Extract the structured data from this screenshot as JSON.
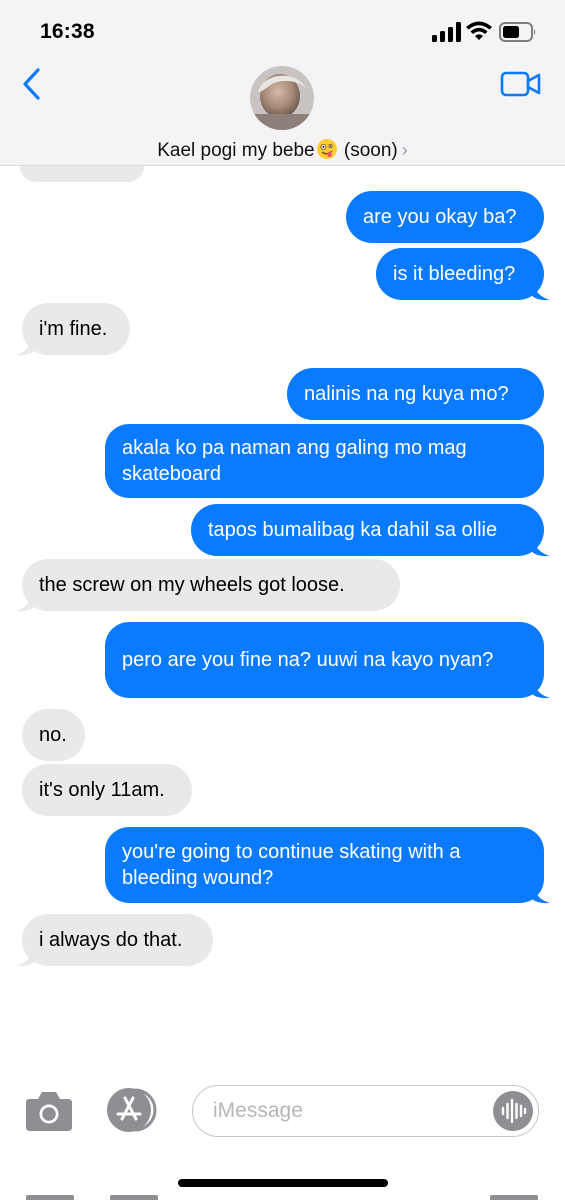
{
  "status_bar": {
    "time": "16:38"
  },
  "header": {
    "contact_name_prefix": "Kael pogi my bebe",
    "contact_emoji": "zany-face-emoji",
    "contact_name_suffix": " (soon)",
    "chevron": "›"
  },
  "messages": [
    {
      "side": "out",
      "text": "are you okay ba?"
    },
    {
      "side": "out",
      "text": "is it bleeding?"
    },
    {
      "side": "in",
      "text": "i'm fine."
    },
    {
      "side": "out",
      "text": "nalinis na ng kuya mo?"
    },
    {
      "side": "out",
      "text": "akala ko pa naman ang galing mo mag skateboard"
    },
    {
      "side": "out",
      "text": "tapos bumalibag ka dahil sa ollie"
    },
    {
      "side": "in",
      "text": "the screw on my wheels got loose."
    },
    {
      "side": "out",
      "text": "pero are you fine na? uuwi na kayo nyan?"
    },
    {
      "side": "in",
      "text": "no."
    },
    {
      "side": "in",
      "text": "it's only 11am."
    },
    {
      "side": "out",
      "text": "you're going to continue skating with a bleeding wound?"
    },
    {
      "side": "in",
      "text": "i always do that."
    }
  ],
  "input_bar": {
    "placeholder": "iMessage",
    "value": ""
  },
  "colors": {
    "outgoing": "#0a7bff",
    "incoming": "#e9e9eb",
    "accent": "#0a7bff"
  },
  "icons": [
    "back-chevron-icon",
    "video-camera-icon",
    "camera-icon",
    "app-store-icon",
    "audio-waveform-icon"
  ]
}
